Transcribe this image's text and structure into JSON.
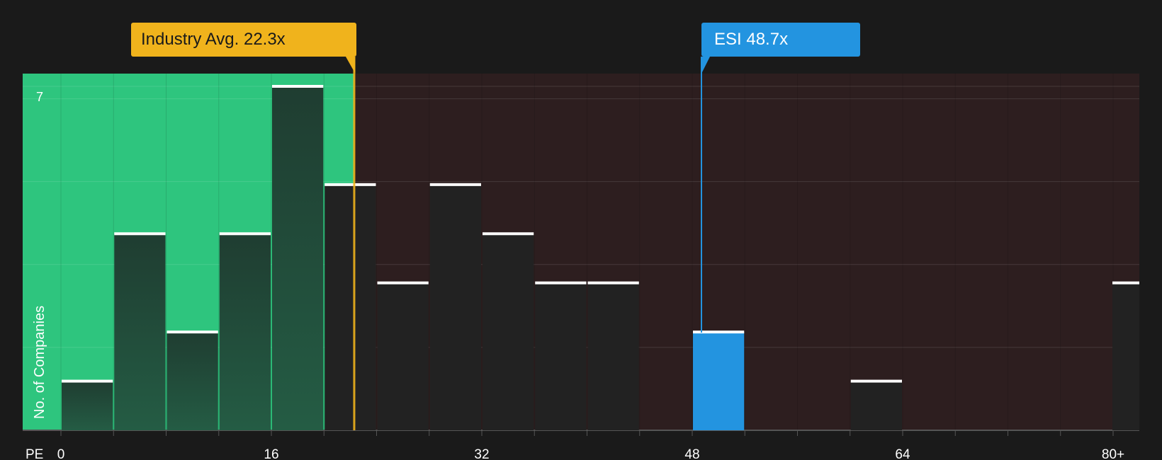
{
  "colors": {
    "background": "#1a1a1a",
    "below_avg_zone": "#2ec57e",
    "above_avg_zone": "#2d1e1f",
    "bar": "#222222",
    "bar_highlight": "#2394e0",
    "industry_line": "#f0b31c",
    "esi_line": "#2394e0",
    "text": "#ffffff"
  },
  "callouts": {
    "industry": "Industry Avg. 22.3x",
    "esi": "ESI 48.7x"
  },
  "chart_data": {
    "type": "bar",
    "ylabel": "No. of Companies",
    "xlabel": "PE",
    "x_ticks": [
      "0",
      "16",
      "32",
      "48",
      "64",
      "80+"
    ],
    "y_ticks": [
      "7"
    ],
    "ylim": [
      0,
      7
    ],
    "bin_width": 4,
    "bars": [
      {
        "start": 0,
        "count": 1
      },
      {
        "start": 4,
        "count": 4
      },
      {
        "start": 8,
        "count": 2
      },
      {
        "start": 12,
        "count": 4
      },
      {
        "start": 16,
        "count": 7
      },
      {
        "start": 20,
        "count": 5
      },
      {
        "start": 24,
        "count": 3
      },
      {
        "start": 28,
        "count": 5
      },
      {
        "start": 32,
        "count": 4
      },
      {
        "start": 36,
        "count": 3
      },
      {
        "start": 40,
        "count": 3
      },
      {
        "start": 48,
        "count": 2,
        "highlight": true
      },
      {
        "start": 60,
        "count": 1
      },
      {
        "start": 80,
        "count": 3
      }
    ],
    "industry_avg": 22.3,
    "esi_value": 48.7,
    "grid": true
  }
}
